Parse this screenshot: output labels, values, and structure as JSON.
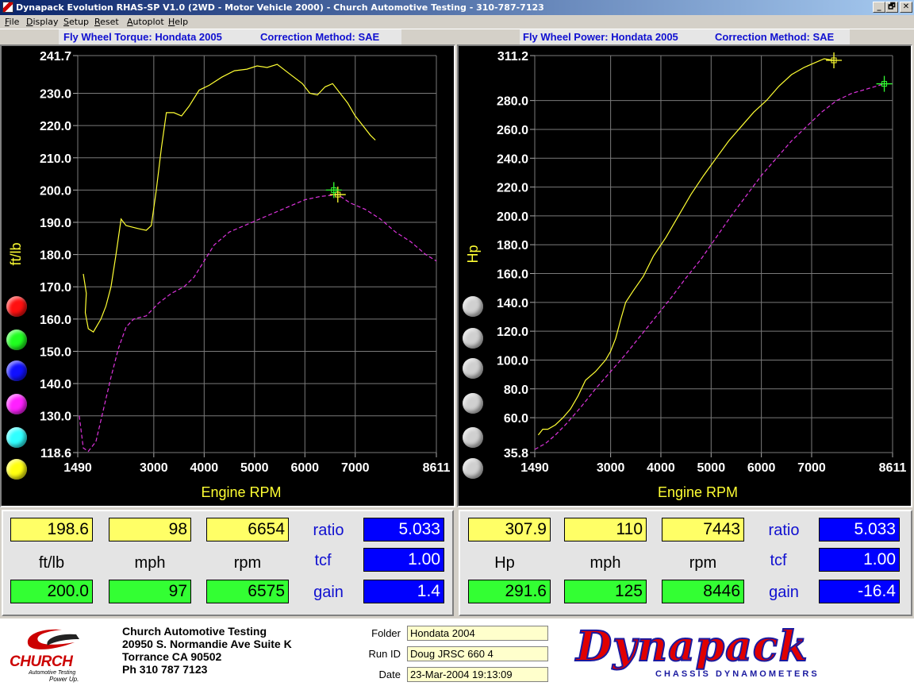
{
  "window": {
    "title": "Dynapack Evolution RHAS-SP V1.0  (2WD - Motor Vehicle 2000) - Church Automotive Testing - 310-787-7123",
    "buttons": [
      "_",
      "🗗",
      "✕"
    ]
  },
  "menu": [
    {
      "label": "File",
      "accel": "F",
      "rest": "ile"
    },
    {
      "label": "Display",
      "accel": "D",
      "rest": "isplay"
    },
    {
      "label": "Setup",
      "accel": "S",
      "rest": "etup"
    },
    {
      "label": "Reset",
      "accel": "R",
      "rest": "eset"
    },
    {
      "label": "Autoplot",
      "accel": "A",
      "rest": "utoplot"
    },
    {
      "label": "Help",
      "accel": "H",
      "rest": "elp"
    }
  ],
  "colors": {
    "accent": "#1010d0",
    "series_primary": "#ffff33",
    "series_secondary": "#dd33dd",
    "readout_yellow": "#ffff66",
    "readout_green": "#33ff33",
    "readout_blue": "#0000ff"
  },
  "torque_chart": {
    "header_left": "Fly Wheel Torque: Hondata 2005",
    "header_right": "Correction Method: SAE",
    "ylabel": "ft/lb",
    "xlabel": "Engine RPM",
    "y_ticks": [
      "241.7",
      "230.0",
      "220.0",
      "210.0",
      "200.0",
      "190.0",
      "180.0",
      "170.0",
      "160.0",
      "150.0",
      "140.0",
      "130.0",
      "118.6"
    ],
    "x_ticks": [
      "1490",
      "3000",
      "4000",
      "5000",
      "6000",
      "7000",
      "8611"
    ]
  },
  "power_chart": {
    "header_left": "Fly Wheel Power: Hondata 2005",
    "header_right": "Correction Method: SAE",
    "ylabel": "Hp",
    "xlabel": "Engine RPM",
    "y_ticks": [
      "311.2",
      "280.0",
      "260.0",
      "240.0",
      "220.0",
      "200.0",
      "180.0",
      "160.0",
      "140.0",
      "120.0",
      "100.0",
      "80.0",
      "60.0",
      "35.8"
    ],
    "x_ticks": [
      "1490",
      "3000",
      "4000",
      "5000",
      "6000",
      "7000",
      "8611"
    ]
  },
  "chart_data": [
    {
      "type": "line",
      "ylabel": "ft/lb",
      "xlabel": "Engine RPM",
      "xlim": [
        1490,
        8611
      ],
      "ylim": [
        118.6,
        241.7
      ],
      "series": [
        {
          "color": "#ffff33",
          "style": "solid",
          "points": [
            [
              1600,
              174
            ],
            [
              1660,
              168
            ],
            [
              1640,
              162
            ],
            [
              1700,
              157
            ],
            [
              1800,
              156
            ],
            [
              1950,
              160
            ],
            [
              2050,
              164
            ],
            [
              2150,
              170
            ],
            [
              2250,
              180
            ],
            [
              2350,
              191
            ],
            [
              2450,
              189
            ],
            [
              2700,
              188
            ],
            [
              2850,
              187.5
            ],
            [
              2950,
              189
            ],
            [
              3050,
              200
            ],
            [
              3150,
              213
            ],
            [
              3250,
              224
            ],
            [
              3400,
              224
            ],
            [
              3550,
              223
            ],
            [
              3700,
              226
            ],
            [
              3900,
              231
            ],
            [
              4100,
              232.5
            ],
            [
              4350,
              235
            ],
            [
              4600,
              237
            ],
            [
              4850,
              237.5
            ],
            [
              5050,
              238.5
            ],
            [
              5250,
              238
            ],
            [
              5450,
              239
            ],
            [
              5700,
              236
            ],
            [
              5950,
              233
            ],
            [
              6100,
              230
            ],
            [
              6250,
              229.5
            ],
            [
              6400,
              232
            ],
            [
              6550,
              233
            ],
            [
              6700,
              230
            ],
            [
              6850,
              227
            ],
            [
              7000,
              223
            ],
            [
              7150,
              220
            ],
            [
              7300,
              217
            ],
            [
              7400,
              215.5
            ]
          ]
        },
        {
          "color": "#dd33dd",
          "style": "dashed",
          "points": [
            [
              1520,
              130
            ],
            [
              1600,
              120
            ],
            [
              1700,
              119
            ],
            [
              1850,
              122
            ],
            [
              2000,
              132
            ],
            [
              2150,
              142
            ],
            [
              2300,
              151
            ],
            [
              2450,
              157.5
            ],
            [
              2600,
              160
            ],
            [
              2850,
              161
            ],
            [
              3100,
              165
            ],
            [
              3350,
              168
            ],
            [
              3600,
              170
            ],
            [
              3800,
              173
            ],
            [
              4000,
              178
            ],
            [
              4200,
              183
            ],
            [
              4500,
              187
            ],
            [
              4800,
              189
            ],
            [
              5100,
              191
            ],
            [
              5400,
              193
            ],
            [
              5700,
              195
            ],
            [
              6000,
              197
            ],
            [
              6300,
              198
            ],
            [
              6654,
              198.6
            ],
            [
              6900,
              196
            ],
            [
              7200,
              194
            ],
            [
              7500,
              191
            ],
            [
              7800,
              187
            ],
            [
              8100,
              184
            ],
            [
              8400,
              180
            ],
            [
              8611,
              178
            ]
          ]
        }
      ],
      "cursor_points": [
        [
          6654,
          198.6
        ],
        [
          6575,
          200.0
        ]
      ]
    },
    {
      "type": "line",
      "ylabel": "Hp",
      "xlabel": "Engine RPM",
      "xlim": [
        1490,
        8611
      ],
      "ylim": [
        35.8,
        311.2
      ],
      "series": [
        {
          "color": "#ffff33",
          "style": "solid",
          "points": [
            [
              1560,
              48
            ],
            [
              1650,
              52
            ],
            [
              1750,
              52
            ],
            [
              1900,
              55
            ],
            [
              2050,
              60
            ],
            [
              2200,
              66
            ],
            [
              2350,
              75
            ],
            [
              2500,
              86
            ],
            [
              2700,
              92
            ],
            [
              2900,
              100
            ],
            [
              3000,
              106
            ],
            [
              3100,
              115
            ],
            [
              3200,
              128
            ],
            [
              3300,
              140
            ],
            [
              3450,
              148
            ],
            [
              3650,
              158
            ],
            [
              3850,
              172
            ],
            [
              4100,
              185
            ],
            [
              4350,
              200
            ],
            [
              4600,
              215
            ],
            [
              4850,
              228
            ],
            [
              5100,
              240
            ],
            [
              5350,
              252
            ],
            [
              5600,
              262
            ],
            [
              5850,
              272
            ],
            [
              6100,
              280
            ],
            [
              6350,
              290
            ],
            [
              6600,
              298
            ],
            [
              6850,
              303
            ],
            [
              7050,
              306
            ],
            [
              7250,
              309
            ],
            [
              7443,
              307.9
            ]
          ]
        },
        {
          "color": "#dd33dd",
          "style": "dashed",
          "points": [
            [
              1490,
              38
            ],
            [
              1700,
              42
            ],
            [
              1900,
              48
            ],
            [
              2100,
              55
            ],
            [
              2400,
              67
            ],
            [
              2700,
              80
            ],
            [
              3000,
              92
            ],
            [
              3300,
              104
            ],
            [
              3600,
              117
            ],
            [
              3900,
              130
            ],
            [
              4200,
              143
            ],
            [
              4500,
              157
            ],
            [
              4800,
              170
            ],
            [
              5100,
              185
            ],
            [
              5400,
              200
            ],
            [
              5700,
              214
            ],
            [
              6000,
              228
            ],
            [
              6300,
              240
            ],
            [
              6600,
              252
            ],
            [
              6900,
              262
            ],
            [
              7200,
              272
            ],
            [
              7500,
              280
            ],
            [
              7800,
              285
            ],
            [
              8100,
              288
            ],
            [
              8446,
              291.6
            ]
          ]
        }
      ],
      "cursor_points": [
        [
          7443,
          307.9
        ],
        [
          8446,
          291.6
        ]
      ]
    }
  ],
  "readouts": {
    "left": {
      "top_values": [
        "198.6",
        "98",
        "6654"
      ],
      "units": [
        "ft/lb",
        "mph",
        "rpm"
      ],
      "bottom_values": [
        "200.0",
        "97",
        "6575"
      ],
      "ratio_label": "ratio",
      "ratio": "5.033",
      "tcf_label": "tcf",
      "tcf": "1.00",
      "gain_label": "gain",
      "gain": "1.4"
    },
    "right": {
      "top_values": [
        "307.9",
        "110",
        "7443"
      ],
      "units": [
        "Hp",
        "mph",
        "rpm"
      ],
      "bottom_values": [
        "291.6",
        "125",
        "8446"
      ],
      "ratio_label": "ratio",
      "ratio": "5.033",
      "tcf_label": "tcf",
      "tcf": "1.00",
      "gain_label": "gain",
      "gain": "-16.4"
    }
  },
  "color_buttons": [
    "#ff1010",
    "#20ff20",
    "#1010ff",
    "#ff20ff",
    "#30ffff",
    "#ffff10"
  ],
  "footer": {
    "logo_text": "CHURCH",
    "logo_sub": "Automotive Testing",
    "logo_tag": "Power Up.",
    "company_lines": [
      "Church Automotive Testing",
      "20950 S. Normandie Ave Suite K",
      "Torrance CA 90502",
      "Ph 310 787 7123"
    ],
    "fields": [
      {
        "label": "Folder",
        "value": "Hondata 2004"
      },
      {
        "label": "Run ID",
        "value": "Doug JRSC 660 4"
      },
      {
        "label": "Date",
        "value": "23-Mar-2004  19:13:09"
      }
    ],
    "brand": "Dynapack",
    "brand_sub": "CHASSIS   DYNAMOMETERS"
  }
}
